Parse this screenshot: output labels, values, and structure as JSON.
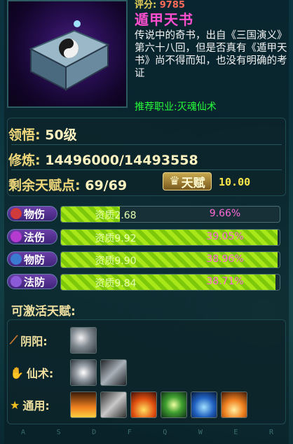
{
  "item": {
    "score_label": "评分:",
    "score_value": "9785",
    "name": "遁甲天书",
    "description": "传说中的奇书，出自《三国演义》第六十八回，但是否真有《遁甲天书》尚不得而知，也没有明确的考证",
    "recommend": "推荐职业:灭魂仙术"
  },
  "stats": {
    "insight_label": "领悟:",
    "insight_value": "50级",
    "train_label": "修炼:",
    "train_value": "14496000/14493558",
    "remaining_label": "剩余天赋点:",
    "remaining_value": "69/69",
    "talent_button": "天赋",
    "talent_value": "10.00"
  },
  "attributes": [
    {
      "label": "物伤",
      "quality": "资质2.68",
      "percent": "9.66%",
      "fill": 0.27,
      "icon_color": "#d03a3a"
    },
    {
      "label": "法伤",
      "quality": "资质9.92",
      "percent": "39.05%",
      "fill": 0.99,
      "icon_color": "#b43ad0"
    },
    {
      "label": "物防",
      "quality": "资质9.90",
      "percent": "38.96%",
      "fill": 0.99,
      "icon_color": "#3a7ad0"
    },
    {
      "label": "法防",
      "quality": "资质9.84",
      "percent": "38.71%",
      "fill": 0.98,
      "icon_color": "#8a5ad8"
    }
  ],
  "activatable": {
    "title": "可激活天赋:",
    "rows": [
      {
        "label": "阴阳:",
        "icon": "staff-icon",
        "skills": [
          "swirl-skill-icon"
        ]
      },
      {
        "label": "仙术:",
        "icon": "hand-icon",
        "skills": [
          "burst-skill-icon",
          "wing-skill-icon"
        ]
      },
      {
        "label": "通用:",
        "icon": "star-icon",
        "skills": [
          "fire-crown-skill-icon",
          "dragon-skill-icon",
          "flame-skill-icon",
          "warrior-skill-icon",
          "aura-skill-icon",
          "blast-skill-icon"
        ]
      }
    ]
  },
  "hotkeys": [
    "A",
    "S",
    "D",
    "F",
    "Q",
    "W",
    "E",
    "R"
  ]
}
